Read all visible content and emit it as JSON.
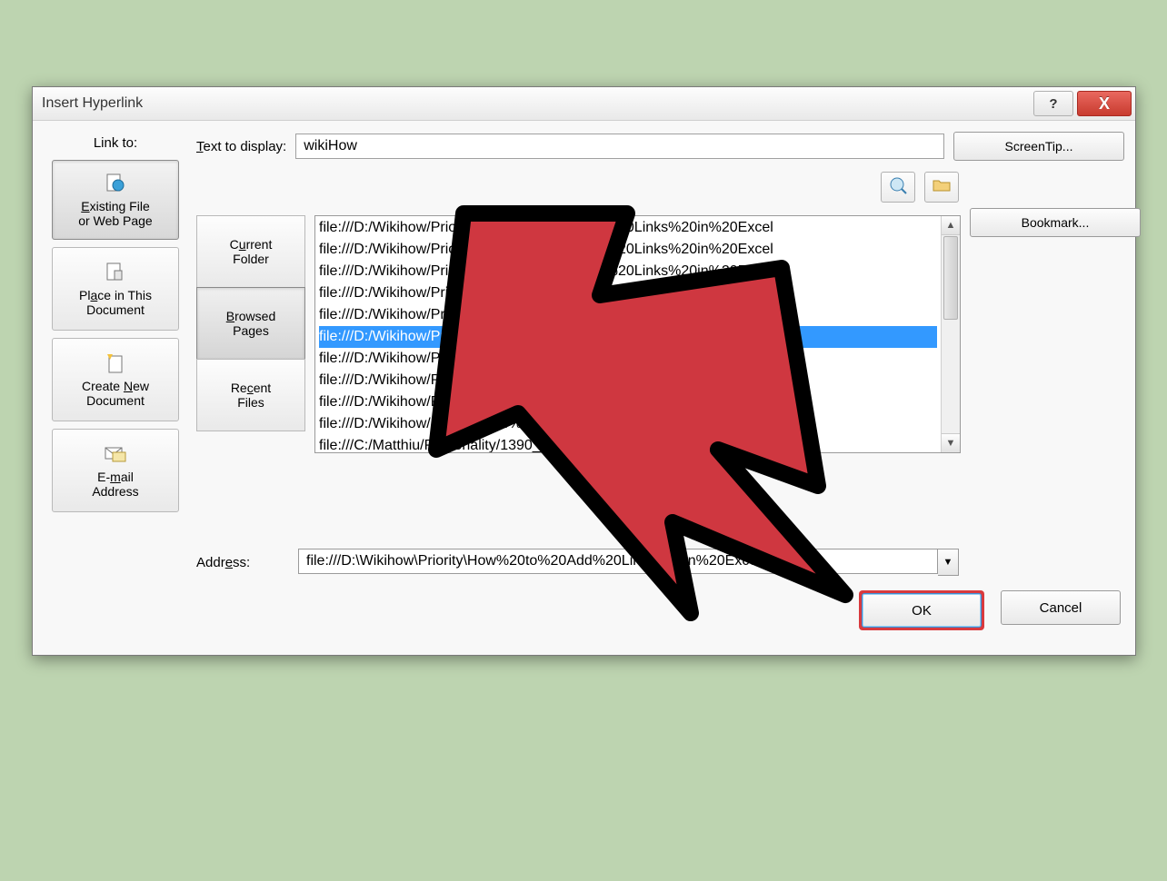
{
  "dialog": {
    "title": "Insert Hyperlink",
    "help_icon": "?",
    "close_icon": "X"
  },
  "linkto": {
    "header": "Link to:",
    "items": [
      {
        "label1": "Existing File",
        "label2": "or Web Page"
      },
      {
        "label1": "Place in This",
        "label2": "Document"
      },
      {
        "label1": "Create New",
        "label2": "Document"
      },
      {
        "label1": "E-mail",
        "label2": "Address"
      }
    ],
    "selected": 0
  },
  "text_display": {
    "label": "Text to display:",
    "value": "wikiHow"
  },
  "buttons": {
    "screentip": "ScreenTip...",
    "bookmark": "Bookmark...",
    "ok": "OK",
    "cancel": "Cancel"
  },
  "tabs": {
    "items": [
      {
        "l1": "Current",
        "l2": "Folder"
      },
      {
        "l1": "Browsed",
        "l2": "Pages"
      },
      {
        "l1": "Recent",
        "l2": "Files"
      }
    ],
    "selected": 1
  },
  "list": {
    "items": [
      "file:///D:/Wikihow/Priority/How%20to%20Add%20Links%20in%20Excel",
      "file:///D:/Wikihow/Priority/How%20to%20Add%20Links%20in%20Excel",
      "file:///D:/Wikihow/Priority/How%20to%20Add%20Links%20in%20Excel",
      "file:///D:/Wikihow/Priority/How%20to%20Add%20Links%20in%20Excel",
      "file:///D:/Wikihow/Priority/How%20to%20Add%20Links%20in%20Excel",
      "file:///D:/Wikihow/Priority/How%20to%20Add%20Links%20in%20Excel",
      "file:///D:/Wikihow/Priority/How%20to%20Add%20Links%20in%20Excel",
      "file:///D:/Wikihow/Priority/How%20to%20Add%20Links%20in%20Excel",
      "file:///D:/Wikihow/Priority/How%20to%20Add%20Links%20in%20Excel",
      "file:///D:/Wikihow/Priority/How%20to%20Add%20Links%20in%20Excel",
      "file:///C:/Matthiu/Personality/1390_91518684"
    ],
    "selected": 5
  },
  "address": {
    "label": "Address:",
    "value": "file:///D:\\Wikihow\\Priority\\How%20to%20Add%20Links%20in%20Excel"
  }
}
